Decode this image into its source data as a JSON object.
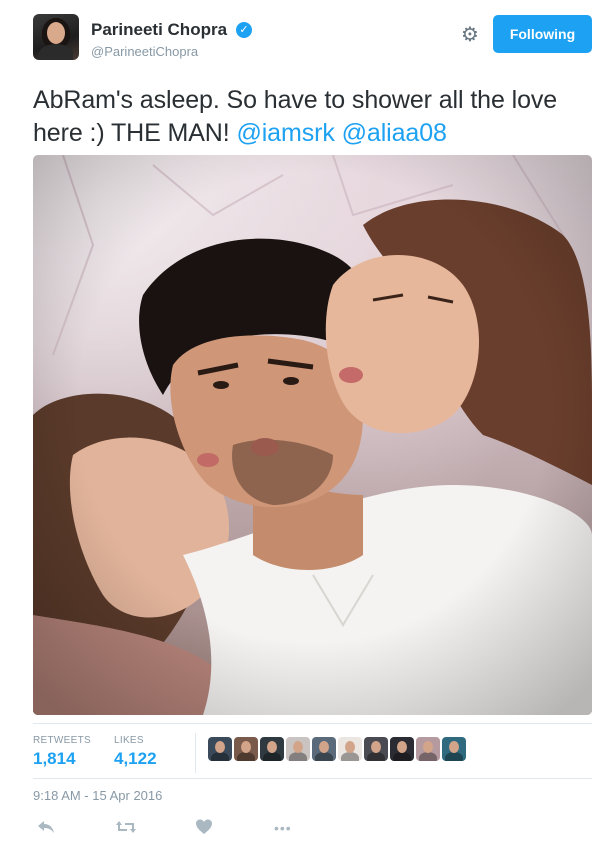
{
  "author": {
    "name": "Parineeti Chopra",
    "handle": "@ParineetiChopra",
    "verified": true
  },
  "header": {
    "settings_icon": "gear-icon",
    "follow_label": "Following"
  },
  "tweet": {
    "text_plain": "AbRam's asleep. So have to shower all the love here :) THE MAN! ",
    "mentions": [
      "@iamsrk",
      "@aliaa08"
    ],
    "timestamp": "9:18 AM - 15 Apr 2016"
  },
  "stats": {
    "retweets_label": "RETWEETS",
    "retweets_value": "1,814",
    "likes_label": "LIKES",
    "likes_value": "4,122"
  },
  "liker_avatar_colors": [
    "#3b4a5a",
    "#7a5a4a",
    "#2e3a40",
    "#c9c4c2",
    "#5a6a7a",
    "#ece6e2",
    "#4a4a52",
    "#2b2b33",
    "#b59aa0",
    "#2f6a7e"
  ],
  "actions": [
    {
      "name": "reply-icon",
      "glyph": "↩"
    },
    {
      "name": "retweet-icon",
      "glyph": "⇄"
    },
    {
      "name": "like-icon",
      "glyph": "♥"
    },
    {
      "name": "more-icon",
      "glyph": "•••"
    }
  ],
  "colors": {
    "accent": "#1da1f2",
    "text": "#292f33",
    "muted": "#8899a6"
  }
}
